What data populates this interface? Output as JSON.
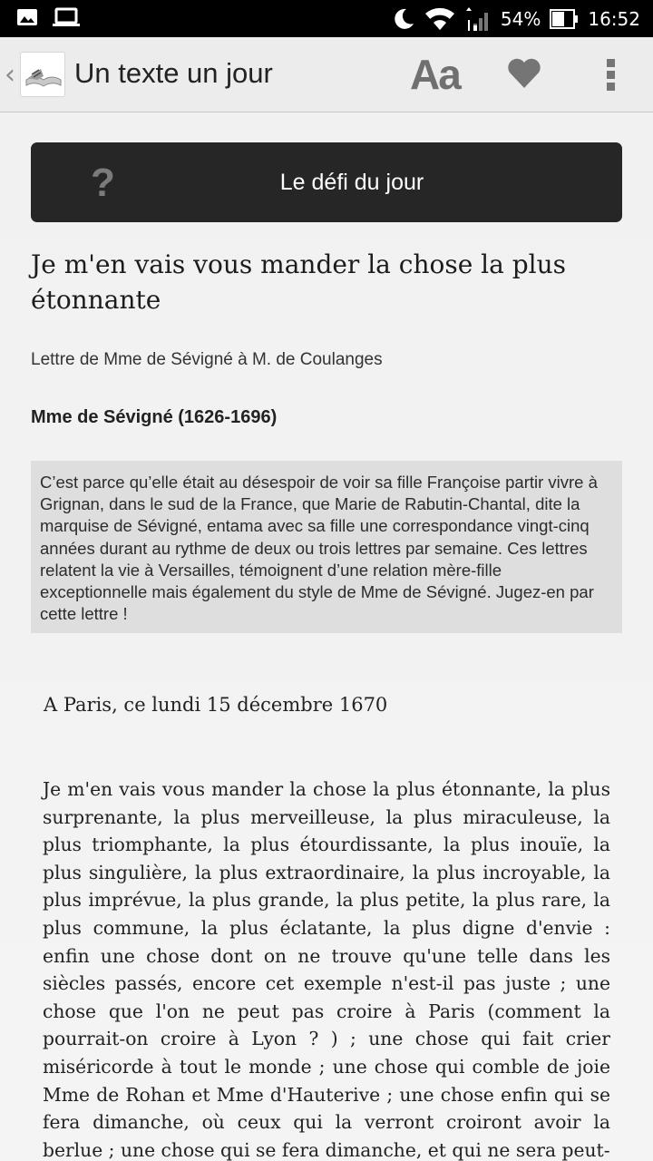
{
  "status_bar": {
    "battery_percent": "54%",
    "time": "16:52",
    "icons": [
      "image-icon",
      "laptop-icon",
      "moon-icon",
      "wifi-icon",
      "signal-icon",
      "battery-icon"
    ]
  },
  "app_bar": {
    "title": "Un texte un jour",
    "font_button_label": "Aa",
    "icons": [
      "back-chevron-icon",
      "app-logo",
      "heart-icon",
      "overflow-menu-icon"
    ]
  },
  "daily_challenge": {
    "icon": "?",
    "label": "Le défi du jour"
  },
  "text": {
    "title": "Je m'en vais vous mander la chose la plus étonnante",
    "subtitle": "Lettre de Mme de Sévigné à M. de Coulanges",
    "author": "Mme de Sévigné (1626-1696)",
    "intro": "C’est parce qu’elle était au désespoir de voir sa fille Françoise partir vivre à Grignan, dans le sud de la France, que Marie de Rabutin-Chantal, dite la marquise de Sévigné, entama avec sa fille une correspondance vingt-cinq années durant au rythme de deux ou trois lettres par semaine. Ces lettres relatent la vie à Versailles, témoignent d’une relation mère-fille exceptionnelle mais également du style de Mme de Sévigné. Jugez-en par cette lettre !",
    "letter_date": "A Paris, ce lundi 15 décembre 1670",
    "letter_body": "Je m'en vais vous mander la chose la plus étonnante, la plus surprenante, la plus merveilleuse, la plus miraculeuse, la plus triomphante, la plus étourdissante, la plus inouïe, la plus singulière, la plus extraordinaire, la plus incroyable, la plus imprévue, la plus grande, la plus petite, la plus rare, la plus commune, la plus éclatante, la plus digne d'envie : enfin une chose dont on ne trouve qu'une telle dans les siècles passés, encore cet exemple n'est-il pas juste ; une chose que l'on ne peut pas croire à Paris (comment la pourrait-on croire à Lyon ? ) ; une chose qui fait crier miséricorde à tout le monde ; une chose qui comble de joie Mme de Rohan et Mme d'Hauterive ; une chose enfin qui se fera dimanche, où ceux qui la verront croiront avoir la berlue ; une chose qui se fera dimanche, et qui ne sera peut-"
  },
  "colors": {
    "status_bar_bg": "#000000",
    "app_bar_bg": "#ececec",
    "challenge_bg": "#262626",
    "intro_bg": "#dedede",
    "page_bg": "#f1f1f1"
  }
}
